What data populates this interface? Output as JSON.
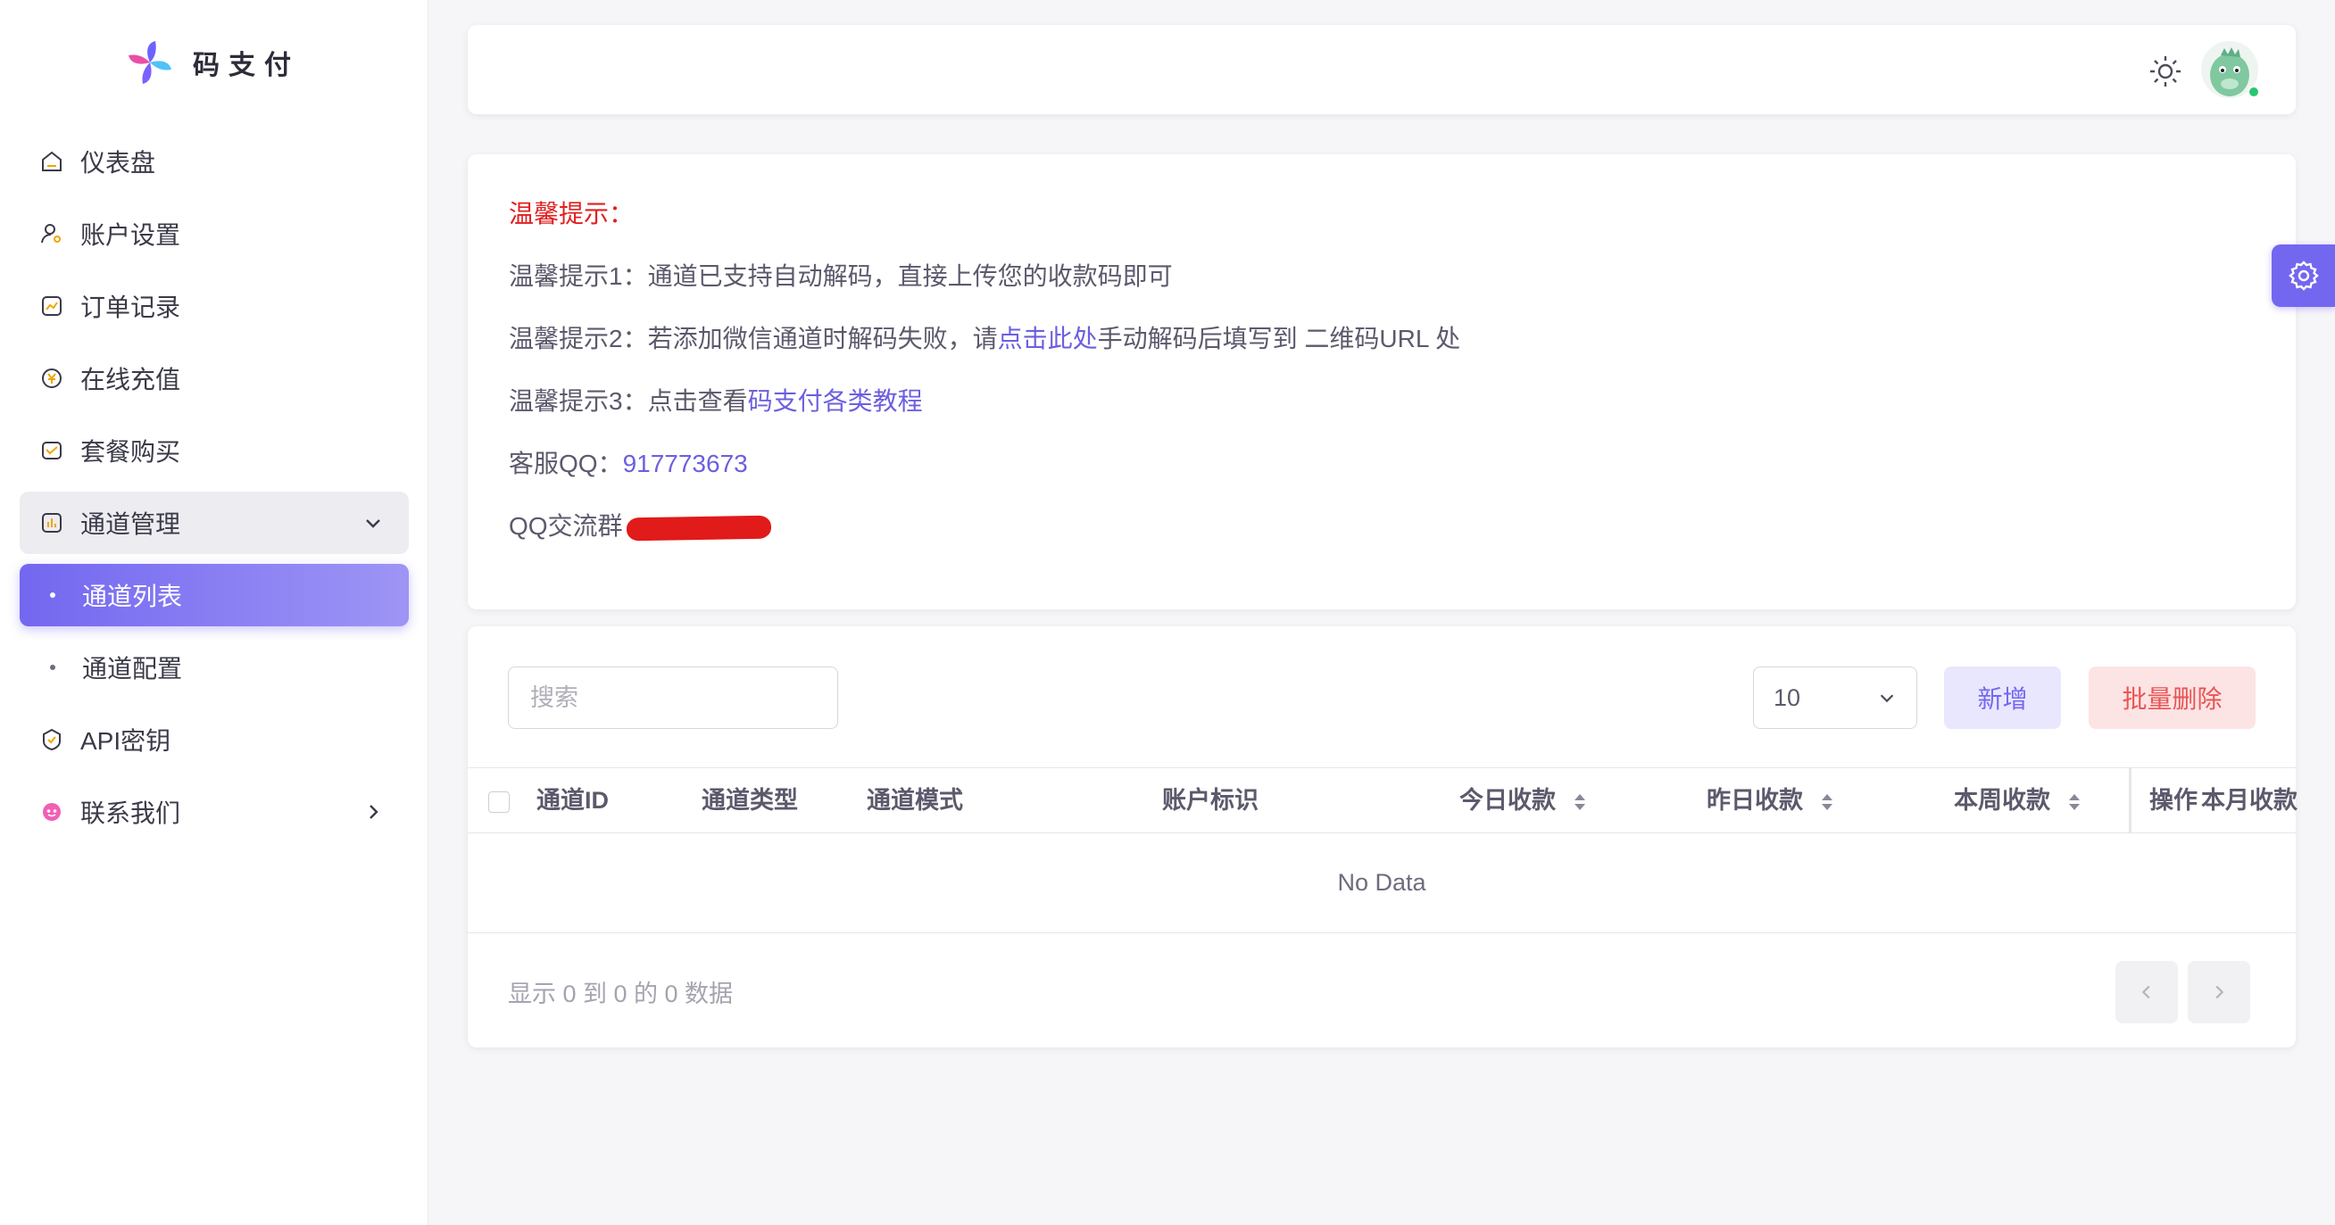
{
  "brand": {
    "name": "码支付"
  },
  "sidebar": {
    "items": [
      {
        "label": "仪表盘",
        "icon": "dashboard-icon"
      },
      {
        "label": "账户设置",
        "icon": "user-settings-icon"
      },
      {
        "label": "订单记录",
        "icon": "orders-icon"
      },
      {
        "label": "在线充值",
        "icon": "recharge-icon"
      },
      {
        "label": "套餐购买",
        "icon": "package-icon"
      },
      {
        "label": "通道管理",
        "icon": "channel-icon",
        "expanded": true
      },
      {
        "label": "通道列表",
        "active": true
      },
      {
        "label": "通道配置"
      },
      {
        "label": "API密钥",
        "icon": "api-key-icon"
      },
      {
        "label": "联系我们",
        "icon": "contact-icon"
      }
    ]
  },
  "tips": {
    "title": "温馨提示：",
    "tip1": "温馨提示1：通道已支持自动解码，直接上传您的收款码即可",
    "tip2_prefix": "温馨提示2：若添加微信通道时解码失败，请",
    "tip2_link": "点击此处",
    "tip2_suffix": "手动解码后填写到 二维码URL 处",
    "tip3_prefix": "温馨提示3：点击查看",
    "tip3_link": "码支付各类教程",
    "qq_label": "客服QQ：",
    "qq_value": "917773673",
    "group_label": "QQ交流群"
  },
  "toolbar": {
    "search_placeholder": "搜索",
    "page_size": "10",
    "add_label": "新增",
    "batch_delete_label": "批量删除"
  },
  "table": {
    "columns": [
      "通道ID",
      "通道类型",
      "通道模式",
      "账户标识",
      "今日收款",
      "昨日收款",
      "本周收款",
      "操作",
      "本月收款"
    ],
    "empty_text": "No Data",
    "info": "显示 0 到 0 的 0 数据"
  },
  "colors": {
    "primary": "#7367f0",
    "danger": "#ea5455",
    "tip_title": "#e02020"
  }
}
